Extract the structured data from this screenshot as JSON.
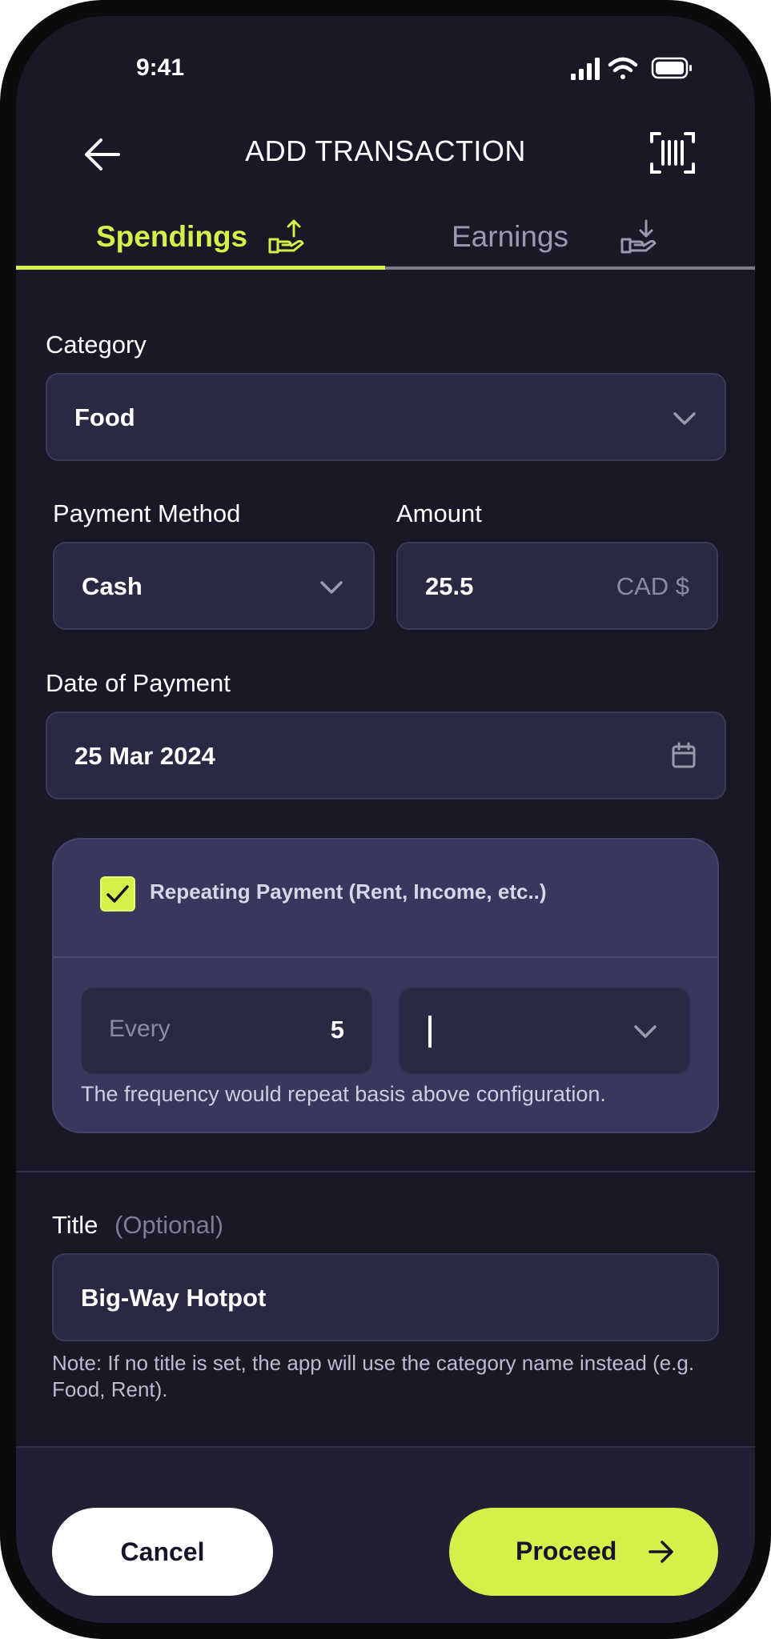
{
  "status_bar": {
    "time": "9:41"
  },
  "header": {
    "title": "ADD TRANSACTION"
  },
  "tabs": [
    {
      "label": "Spendings",
      "active": true
    },
    {
      "label": "Earnings",
      "active": false
    }
  ],
  "form": {
    "category": {
      "label": "Category",
      "value": "Food"
    },
    "payment_method": {
      "label": "Payment Method",
      "value": "Cash"
    },
    "amount": {
      "label": "Amount",
      "value": "25.5",
      "currency": "CAD $"
    },
    "date": {
      "label": "Date of Payment",
      "value": "25 Mar 2024"
    },
    "repeating": {
      "checked": true,
      "label": "Repeating Payment (Rent, Income, etc..)",
      "every_label": "Every",
      "every_value": "5",
      "unit_value": "",
      "note": "The frequency would repeat basis above configuration."
    },
    "title": {
      "label": "Title",
      "optional": "(Optional)",
      "value": "Big-Way Hotpot",
      "note": "Note: If no title is set, the app will use the category name instead (e.g. Food, Rent)."
    }
  },
  "actions": {
    "cancel": "Cancel",
    "proceed": "Proceed"
  },
  "colors": {
    "accent": "#d4f04a",
    "background": "#191827",
    "field": "#2a2944",
    "card": "#38375e"
  }
}
